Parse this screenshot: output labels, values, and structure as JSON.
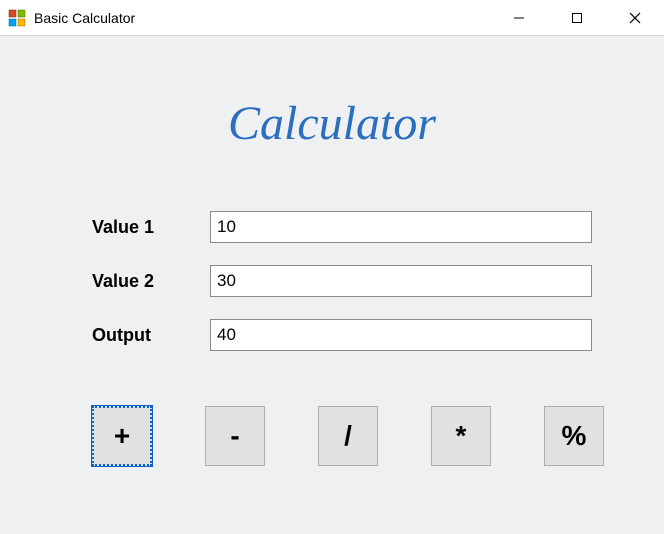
{
  "window": {
    "title": "Basic Calculator"
  },
  "heading": "Calculator",
  "fields": {
    "value1": {
      "label": "Value 1",
      "value": "10"
    },
    "value2": {
      "label": "Value 2",
      "value": "30"
    },
    "output": {
      "label": "Output",
      "value": "40"
    }
  },
  "ops": {
    "add": "+",
    "subtract": "-",
    "divide": "/",
    "multiply": "*",
    "modulo": "%"
  }
}
